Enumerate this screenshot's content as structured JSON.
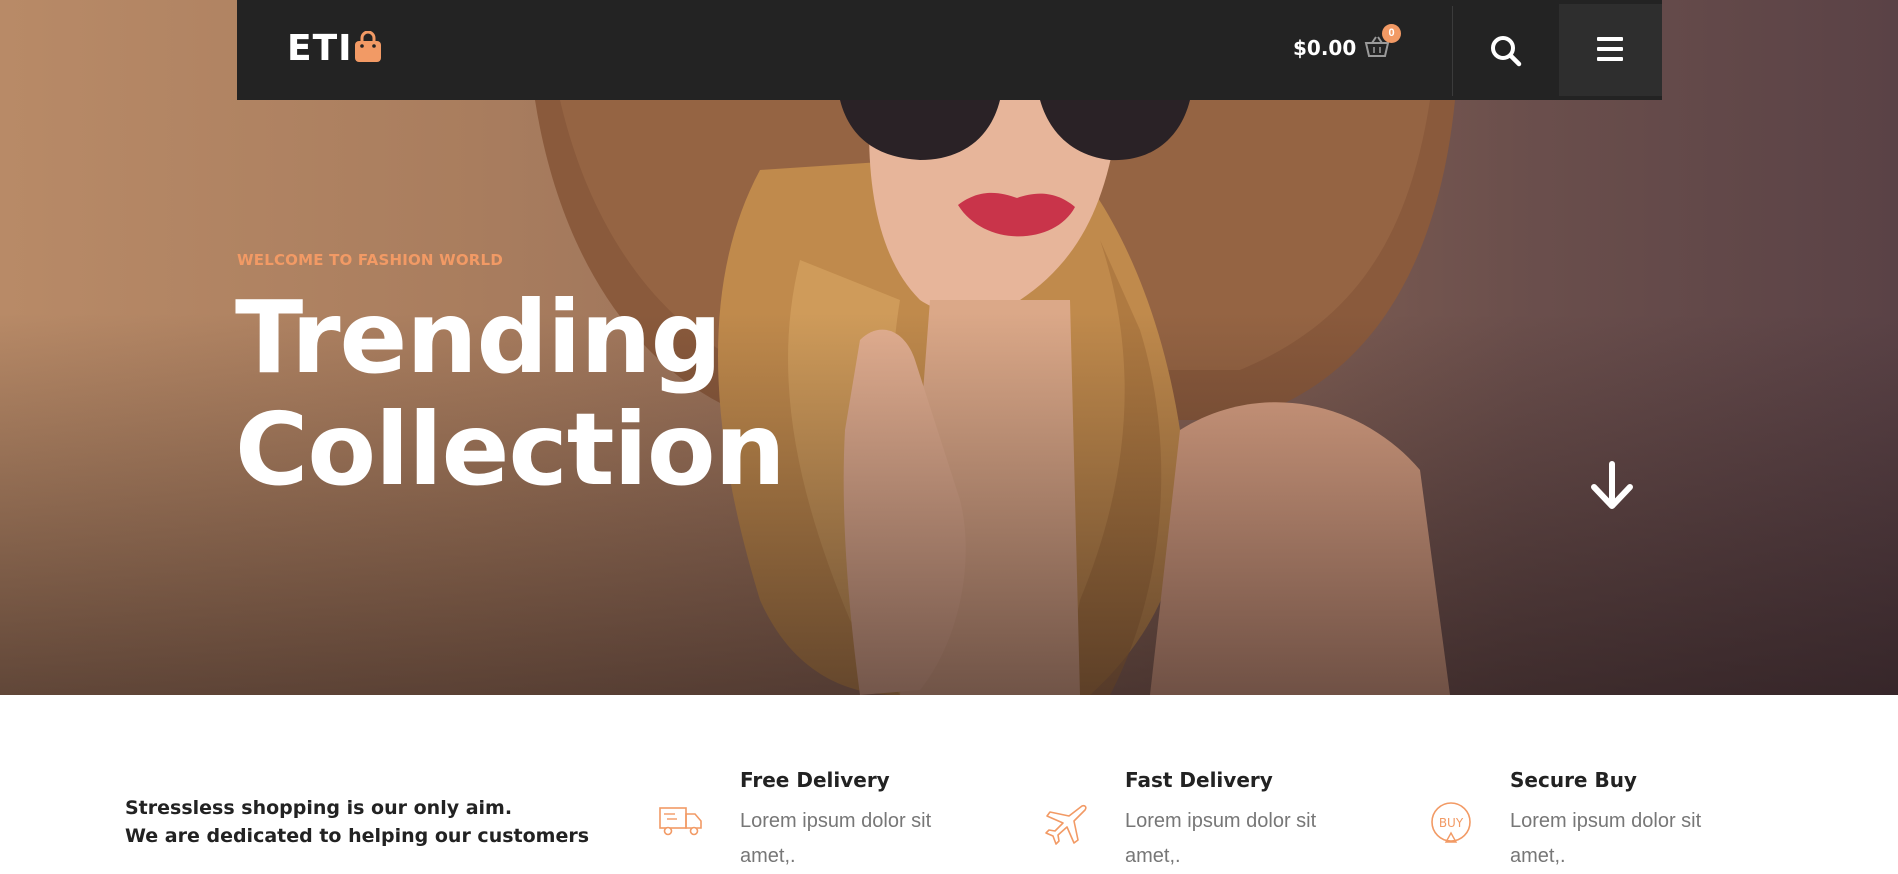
{
  "header": {
    "logo_text": "ETI",
    "cart_total": "$0.00",
    "cart_count": "0",
    "icons": [
      "shopping-bag-icon",
      "basket-icon",
      "search-icon",
      "hamburger-menu-icon"
    ]
  },
  "hero": {
    "eyebrow": "WELCOME TO FASHION WORLD",
    "headline_line1": "Trending",
    "headline_line2": "Collection",
    "scroll_icon": "arrow-down-icon"
  },
  "features": {
    "tagline_line1": "Stressless shopping is our only aim.",
    "tagline_line2": "We are dedicated to helping our customers",
    "items": [
      {
        "title": "Free Delivery",
        "description": "Lorem ipsum dolor sit amet,.",
        "icon": "truck-icon"
      },
      {
        "title": "Fast Delivery",
        "description": "Lorem ipsum dolor sit amet,.",
        "icon": "airplane-icon"
      },
      {
        "title": "Secure Buy",
        "description": "Lorem ipsum dolor sit amet,.",
        "icon": "buy-badge-icon",
        "icon_text": "BUY"
      }
    ]
  },
  "colors": {
    "accent": "#f29a65",
    "header_bg": "#232323",
    "text_dark": "#222222",
    "text_muted": "#777777"
  }
}
